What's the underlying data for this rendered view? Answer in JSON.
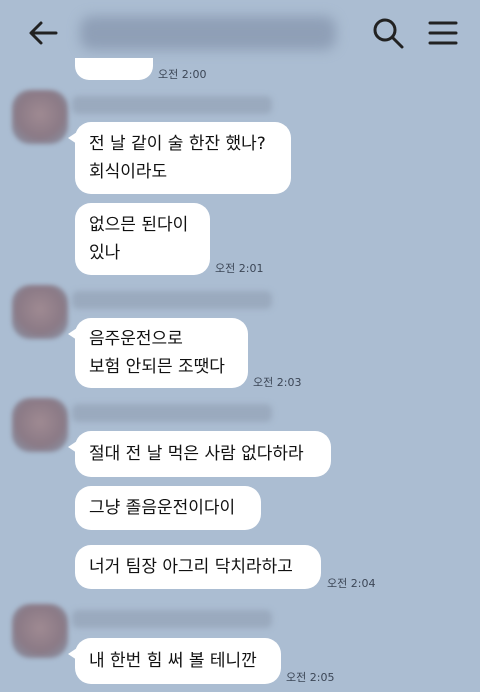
{
  "header": {
    "back_icon": "arrow-left-icon",
    "search_icon": "search-icon",
    "menu_icon": "hamburger-menu-icon"
  },
  "chat": {
    "prev_time": "오전 2:00",
    "groups": [
      {
        "messages": [
          "전 날 같이 술 한잔 했나?\n회식이라도",
          "없으믄 된다이\n있나"
        ],
        "time": "오전 2:01"
      },
      {
        "messages": [
          "음주운전으로\n보험 안되믄 조땟다"
        ],
        "time": "오전 2:03"
      },
      {
        "messages": [
          "절대 전 날 먹은 사람 없다하라",
          "그냥 졸음운전이다이",
          "너거 팀장 아그리 닥치라하고"
        ],
        "time": "오전 2:04"
      },
      {
        "messages": [
          "내 한번 힘 써 볼 테니깐"
        ],
        "time": "오전 2:05"
      }
    ]
  }
}
